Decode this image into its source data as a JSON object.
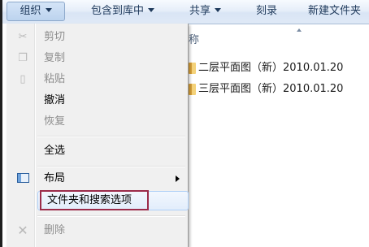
{
  "toolbar": {
    "organize_label": "组织",
    "include_library_label": "包含到库中",
    "share_label": "共享",
    "burn_label": "刻录",
    "new_folder_label": "新建文件夹"
  },
  "file_list": {
    "column_header": "称",
    "items": [
      {
        "name": "二层平面图（新）2010.01.20"
      },
      {
        "name": "三层平面图（新）2010.01.20"
      }
    ]
  },
  "menu": {
    "cut": "剪切",
    "copy": "复制",
    "paste": "粘贴",
    "undo": "撤消",
    "redo": "恢复",
    "select_all": "全选",
    "layout": "布局",
    "folder_options": "文件夹和搜索选项",
    "delete": "删除"
  },
  "colors": {
    "highlight_border": "#9b2b4a",
    "toolbar_text": "#1e395b"
  }
}
